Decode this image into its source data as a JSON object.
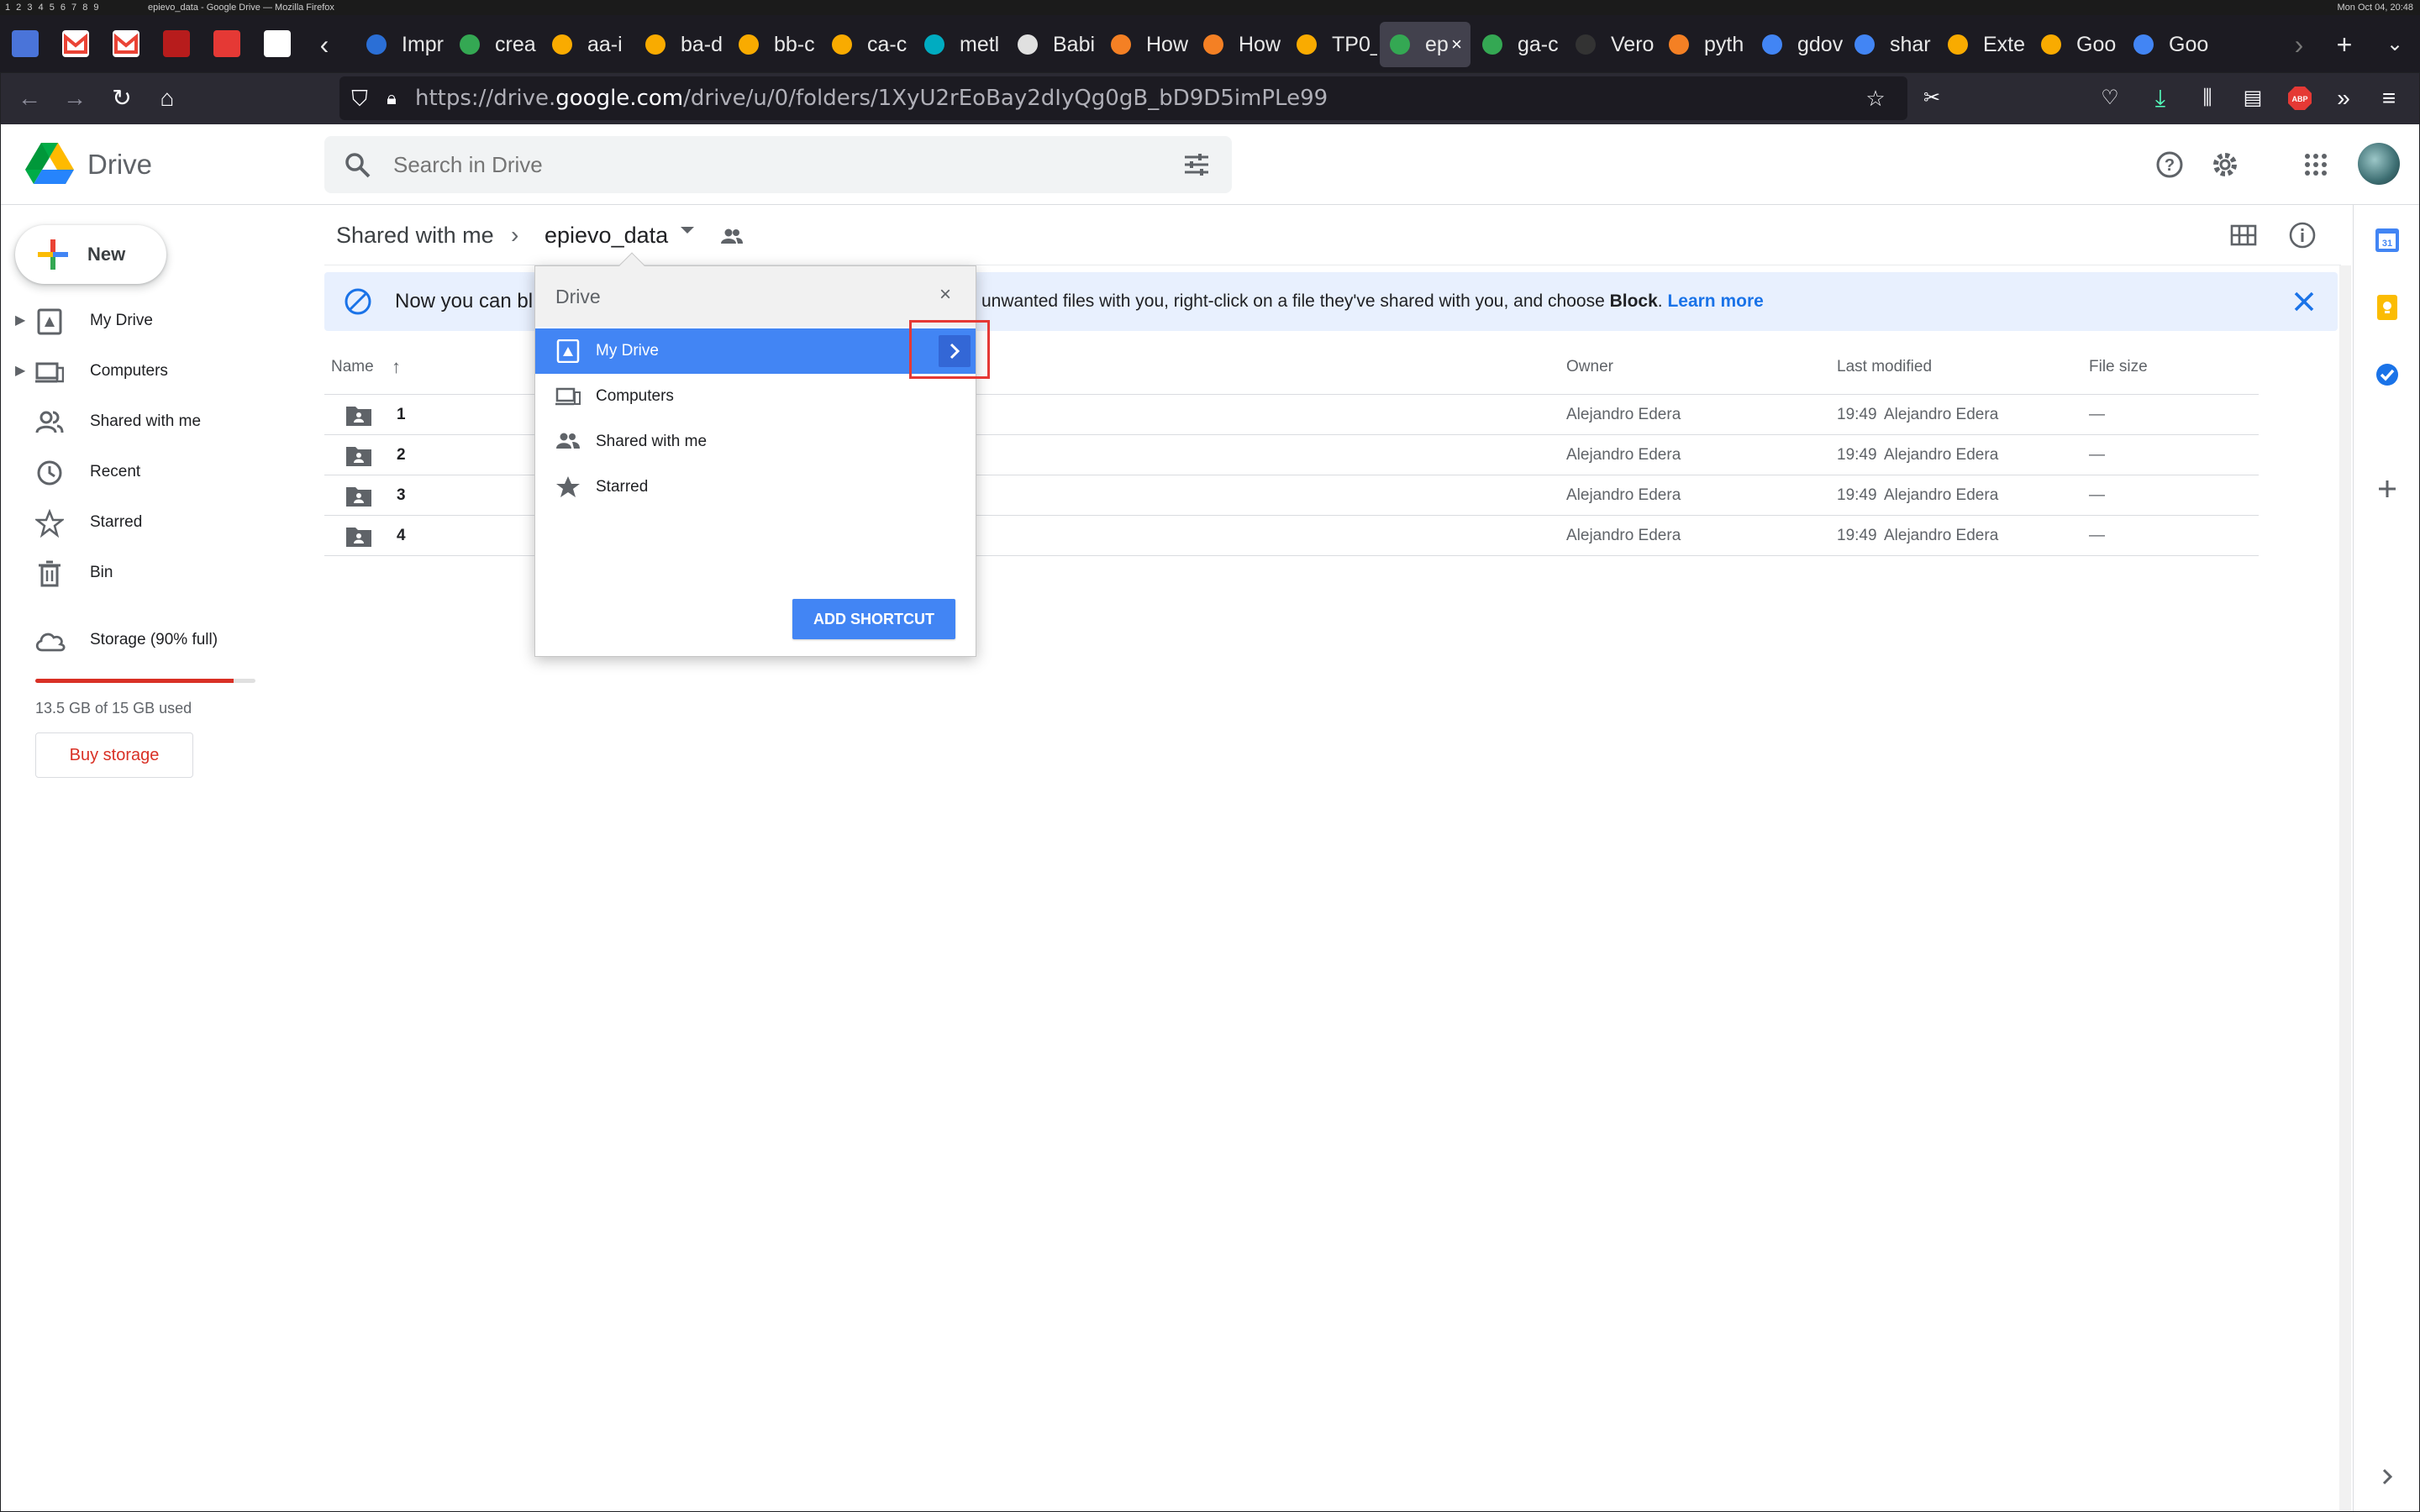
{
  "system_bar": {
    "workspaces": "1 2 3 4   5  6  7  8  9",
    "window_title": "epievo_data - Google Drive — Mozilla Firefox",
    "clock": "Mon Oct 04, 20:48"
  },
  "browser": {
    "tabs": [
      {
        "label": "Impr",
        "color": "#2b6fd6"
      },
      {
        "label": "crea",
        "color": "#34a853"
      },
      {
        "label": "aa-i",
        "color": "#f9ab00"
      },
      {
        "label": "ba-d",
        "color": "#f9ab00"
      },
      {
        "label": "bb-c",
        "color": "#f9ab00"
      },
      {
        "label": "ca-c",
        "color": "#f9ab00"
      },
      {
        "label": "metl",
        "color": "#00acc1"
      },
      {
        "label": "Babi",
        "color": "#e0e0e0"
      },
      {
        "label": "How",
        "color": "#f48024"
      },
      {
        "label": "How",
        "color": "#f48024"
      },
      {
        "label": "TP0_",
        "color": "#f9ab00"
      },
      {
        "label": "ep",
        "color": "#34a853"
      },
      {
        "label": "ga-c",
        "color": "#34a853"
      },
      {
        "label": "Vero",
        "color": "#333333"
      },
      {
        "label": "pyth",
        "color": "#f48024"
      },
      {
        "label": "gdov",
        "color": "#4285f4"
      },
      {
        "label": "shar",
        "color": "#4285f4"
      },
      {
        "label": "Exte",
        "color": "#f9ab00"
      },
      {
        "label": "Goo",
        "color": "#f9ab00"
      },
      {
        "label": "Goo",
        "color": "#4285f4"
      }
    ],
    "url_host_prefix": "https://drive.",
    "url_host": "google.com",
    "url_path": "/drive/u/0/folders/1XyU2rEoBay2dIyQg0gB_bD9D5imPLe99"
  },
  "drive": {
    "brand": "Drive",
    "search_placeholder": "Search in Drive",
    "new_label": "New",
    "nav": [
      {
        "label": "My Drive",
        "icon": "my-drive-icon",
        "has_arrow": true
      },
      {
        "label": "Computers",
        "icon": "computers-icon",
        "has_arrow": true
      },
      {
        "label": "Shared with me",
        "icon": "shared-icon",
        "has_arrow": false
      },
      {
        "label": "Recent",
        "icon": "clock-icon",
        "has_arrow": false
      },
      {
        "label": "Starred",
        "icon": "star-icon",
        "has_arrow": false
      },
      {
        "label": "Bin",
        "icon": "trash-icon",
        "has_arrow": false
      }
    ],
    "storage": {
      "label": "Storage (90% full)",
      "fraction_used": 0.9,
      "used_text": "13.5 GB of 15 GB used",
      "buy_label": "Buy storage",
      "bar_color": "#d93025"
    },
    "breadcrumb": {
      "root": "Shared with me",
      "separator": "›",
      "current": "epievo_data"
    },
    "banner": {
      "text_start": "Now you can bl",
      "text_tail": "unwanted files with you, right-click on a file they've shared with you, and choose ",
      "bold_word": "Block",
      "link": "Learn more"
    },
    "columns": {
      "name": "Name",
      "owner": "Owner",
      "modified": "Last modified",
      "size": "File size"
    },
    "files": [
      {
        "name": "1",
        "owner": "Alejandro Edera",
        "modified_time": "19:49",
        "modified_by": "Alejandro Edera",
        "size": "—"
      },
      {
        "name": "2",
        "owner": "Alejandro Edera",
        "modified_time": "19:49",
        "modified_by": "Alejandro Edera",
        "size": "—"
      },
      {
        "name": "3",
        "owner": "Alejandro Edera",
        "modified_time": "19:49",
        "modified_by": "Alejandro Edera",
        "size": "—"
      },
      {
        "name": "4",
        "owner": "Alejandro Edera",
        "modified_time": "19:49",
        "modified_by": "Alejandro Edera",
        "size": "—"
      }
    ],
    "dialog": {
      "title": "Drive",
      "close": "×",
      "items": [
        {
          "label": "My Drive",
          "selected": true
        },
        {
          "label": "Computers",
          "selected": false
        },
        {
          "label": "Shared with me",
          "selected": false
        },
        {
          "label": "Starred",
          "selected": false
        }
      ],
      "action": "ADD SHORTCUT"
    }
  }
}
